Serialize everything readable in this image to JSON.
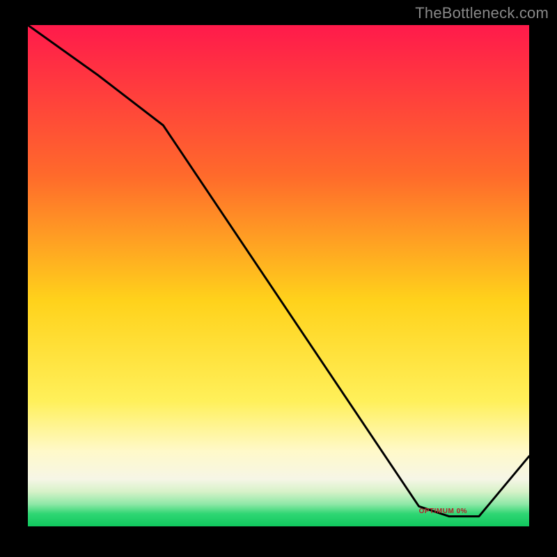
{
  "watermark": "TheBottleneck.com",
  "floor_label": "OPTIMUM 0%",
  "colors": {
    "line": "#000000",
    "top": "#ff1a4b",
    "mid_warm": "#ff9a1a",
    "mid_yellow": "#ffe100",
    "pale_yellow": "#fff79a",
    "off_white": "#f9f9e6",
    "pale_green": "#c9f2c9",
    "green": "#1ecf66",
    "frame": "#000000"
  },
  "chart_data": {
    "type": "line",
    "title": "",
    "xlabel": "",
    "ylabel": "",
    "xlim": [
      0,
      100
    ],
    "ylim": [
      0,
      100
    ],
    "x": [
      0,
      14,
      27,
      78,
      84,
      90,
      100
    ],
    "values": [
      100,
      90,
      80,
      4,
      2,
      2,
      14
    ],
    "optimum_y": 2,
    "optimum_x_range": [
      84,
      90
    ],
    "gradient_stops": [
      {
        "pos": 0.0,
        "color": "#ff1a4b"
      },
      {
        "pos": 0.3,
        "color": "#ff6a2b"
      },
      {
        "pos": 0.55,
        "color": "#ffd21b"
      },
      {
        "pos": 0.75,
        "color": "#fff05a"
      },
      {
        "pos": 0.85,
        "color": "#fff9c9"
      },
      {
        "pos": 0.905,
        "color": "#f6f6e6"
      },
      {
        "pos": 0.93,
        "color": "#d7f2c9"
      },
      {
        "pos": 0.955,
        "color": "#8fe8a7"
      },
      {
        "pos": 0.975,
        "color": "#2fd673"
      },
      {
        "pos": 1.0,
        "color": "#10c85e"
      }
    ]
  }
}
